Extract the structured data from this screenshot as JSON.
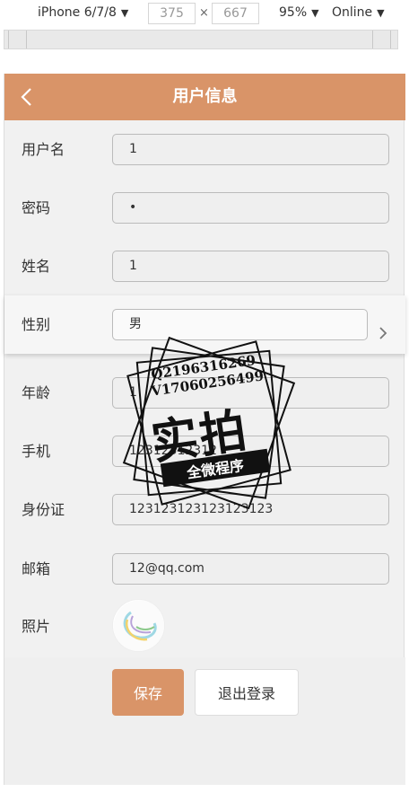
{
  "devtools": {
    "device": "iPhone 6/7/8",
    "width": "375",
    "times": "×",
    "height": "667",
    "zoom": "95%",
    "network": "Online"
  },
  "nav": {
    "title": "用户信息"
  },
  "form": {
    "username": {
      "label": "用户名",
      "value": "1"
    },
    "password": {
      "label": "密码",
      "value": "•"
    },
    "name": {
      "label": "姓名",
      "value": "1"
    },
    "gender": {
      "label": "性别",
      "value": "男"
    },
    "age": {
      "label": "年龄",
      "value": "1"
    },
    "phone": {
      "label": "手机",
      "value": "12312312312"
    },
    "id_card": {
      "label": "身份证",
      "value": "123123123123123123"
    },
    "email": {
      "label": "邮箱",
      "value": "12@qq.com"
    },
    "photo": {
      "label": "照片"
    }
  },
  "buttons": {
    "save": "保存",
    "logout": "退出登录"
  },
  "watermark": {
    "line1": "Q2196316269",
    "line2": "V17060256499",
    "big": "实拍",
    "band": "全微程序"
  },
  "colors": {
    "accent": "#d99468",
    "background": "#f1f1f1"
  }
}
